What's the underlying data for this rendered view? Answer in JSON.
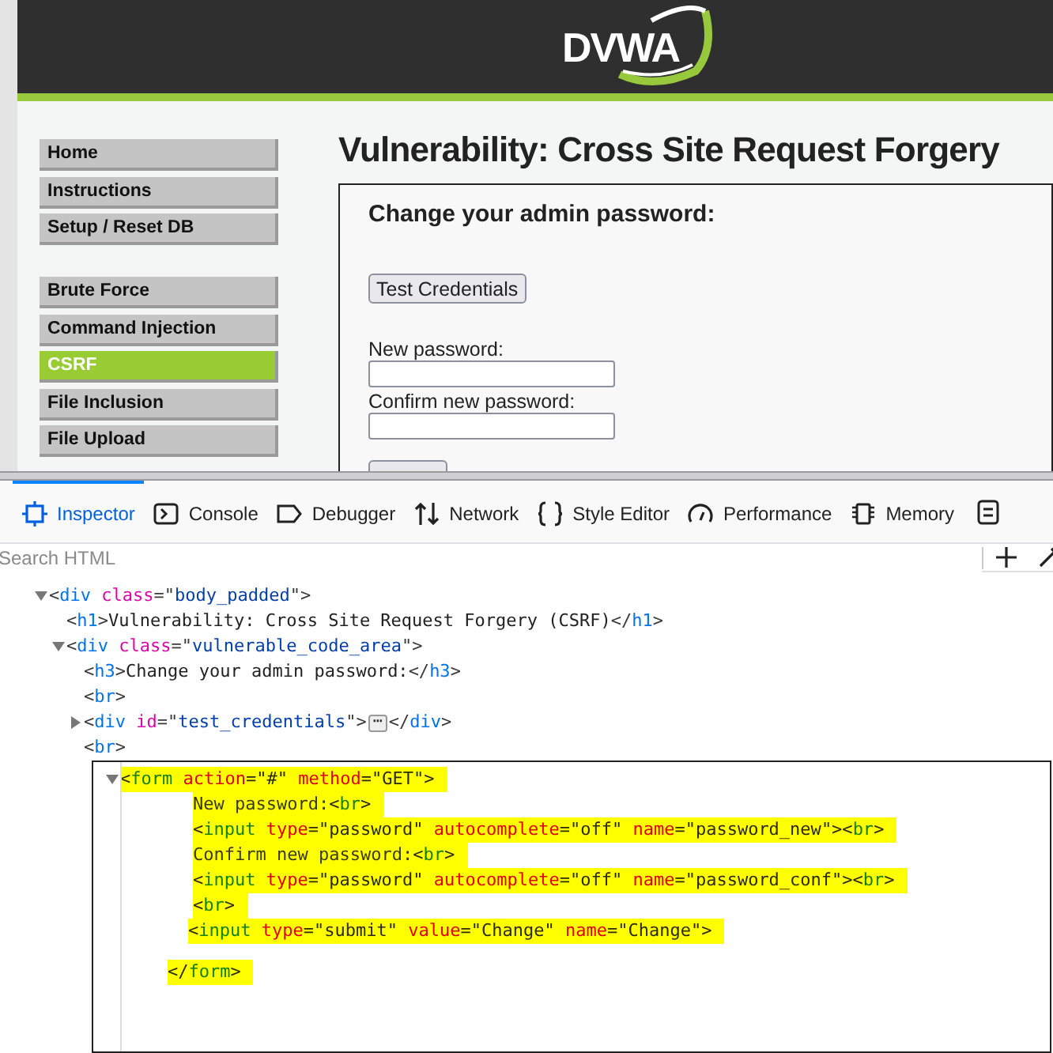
{
  "page": {
    "logo": "DVWA",
    "menu_groups": [
      [
        {
          "label": "Home",
          "selected": false
        },
        {
          "label": "Instructions",
          "selected": false
        },
        {
          "label": "Setup / Reset DB",
          "selected": false
        }
      ],
      [
        {
          "label": "Brute Force",
          "selected": false
        },
        {
          "label": "Command Injection",
          "selected": false
        },
        {
          "label": "CSRF",
          "selected": true
        },
        {
          "label": "File Inclusion",
          "selected": false
        },
        {
          "label": "File Upload",
          "selected": false
        }
      ]
    ],
    "title": "Vulnerability: Cross Site Request Forgery",
    "form": {
      "heading": "Change your admin password:",
      "test_button": "Test Credentials",
      "new_label": "New password:",
      "confirm_label": "Confirm new password:"
    }
  },
  "devtools": {
    "tabs": [
      {
        "label": "Inspector",
        "selected": true
      },
      {
        "label": "Console",
        "selected": false
      },
      {
        "label": "Debugger",
        "selected": false
      },
      {
        "label": "Network",
        "selected": false
      },
      {
        "label": "Style Editor",
        "selected": false
      },
      {
        "label": "Performance",
        "selected": false
      },
      {
        "label": "Memory",
        "selected": false
      }
    ],
    "search": {
      "placeholder": "Search HTML"
    },
    "tree": [
      {
        "expanded": true,
        "tokens": [
          {
            "kind": "p",
            "text": "<"
          },
          {
            "kind": "tag",
            "text": "div"
          },
          {
            "kind": "attr",
            "text": " class"
          },
          {
            "kind": "p",
            "text": "=\""
          },
          {
            "kind": "val",
            "text": "body_padded"
          },
          {
            "kind": "p",
            "text": "\">"
          }
        ],
        "children": [
          {
            "tokens": [
              {
                "kind": "p",
                "text": "<"
              },
              {
                "kind": "tag",
                "text": "h1"
              },
              {
                "kind": "p",
                "text": ">"
              },
              {
                "kind": "text",
                "text": "Vulnerability: Cross Site Request Forgery (CSRF)"
              },
              {
                "kind": "p",
                "text": "</"
              },
              {
                "kind": "tag",
                "text": "h1"
              },
              {
                "kind": "p",
                "text": ">"
              }
            ]
          },
          {
            "expanded": true,
            "tokens": [
              {
                "kind": "p",
                "text": "<"
              },
              {
                "kind": "tag",
                "text": "div"
              },
              {
                "kind": "attr",
                "text": " class"
              },
              {
                "kind": "p",
                "text": "=\""
              },
              {
                "kind": "val",
                "text": "vulnerable_code_area"
              },
              {
                "kind": "p",
                "text": "\">"
              }
            ],
            "children": [
              {
                "tokens": [
                  {
                    "kind": "p",
                    "text": "<"
                  },
                  {
                    "kind": "tag",
                    "text": "h3"
                  },
                  {
                    "kind": "p",
                    "text": ">"
                  },
                  {
                    "kind": "text",
                    "text": "Change your admin password:"
                  },
                  {
                    "kind": "p",
                    "text": "</"
                  },
                  {
                    "kind": "tag",
                    "text": "h3"
                  },
                  {
                    "kind": "p",
                    "text": ">"
                  }
                ]
              },
              {
                "tokens": [
                  {
                    "kind": "p",
                    "text": "<"
                  },
                  {
                    "kind": "tag",
                    "text": "br"
                  },
                  {
                    "kind": "p",
                    "text": ">"
                  }
                ]
              },
              {
                "expanded": false,
                "tokens": [
                  {
                    "kind": "p",
                    "text": "<"
                  },
                  {
                    "kind": "tag",
                    "text": "div"
                  },
                  {
                    "kind": "attr",
                    "text": " id"
                  },
                  {
                    "kind": "p",
                    "text": "=\""
                  },
                  {
                    "kind": "val",
                    "text": "test_credentials"
                  },
                  {
                    "kind": "p",
                    "text": "\">"
                  },
                  {
                    "kind": "more",
                    "text": "⋯"
                  },
                  {
                    "kind": "p",
                    "text": "</"
                  },
                  {
                    "kind": "tag",
                    "text": "div"
                  },
                  {
                    "kind": "p",
                    "text": ">"
                  }
                ]
              },
              {
                "tokens": [
                  {
                    "kind": "p",
                    "text": "<"
                  },
                  {
                    "kind": "tag",
                    "text": "br"
                  },
                  {
                    "kind": "p",
                    "text": ">"
                  }
                ]
              },
              {
                "expanded": true,
                "boxed": true,
                "highlighted": true,
                "tokens": [
                  {
                    "kind": "p",
                    "text": "<"
                  },
                  {
                    "kind": "tag",
                    "text": "form"
                  },
                  {
                    "kind": "attr",
                    "text": " action"
                  },
                  {
                    "kind": "p",
                    "text": "=\""
                  },
                  {
                    "kind": "val",
                    "text": "#"
                  },
                  {
                    "kind": "p",
                    "text": "\""
                  },
                  {
                    "kind": "attr",
                    "text": " method"
                  },
                  {
                    "kind": "p",
                    "text": "=\""
                  },
                  {
                    "kind": "val",
                    "text": "GET"
                  },
                  {
                    "kind": "p",
                    "text": "\">"
                  }
                ],
                "children": [
                  {
                    "highlighted": true,
                    "tokens": [
                      {
                        "kind": "text",
                        "text": "New password:"
                      },
                      {
                        "kind": "p",
                        "text": "<"
                      },
                      {
                        "kind": "tag",
                        "text": "br"
                      },
                      {
                        "kind": "p",
                        "text": ">"
                      }
                    ]
                  },
                  {
                    "highlighted": true,
                    "tokens": [
                      {
                        "kind": "p",
                        "text": "<"
                      },
                      {
                        "kind": "tag",
                        "text": "input"
                      },
                      {
                        "kind": "attr",
                        "text": " type"
                      },
                      {
                        "kind": "p",
                        "text": "=\""
                      },
                      {
                        "kind": "val",
                        "text": "password"
                      },
                      {
                        "kind": "p",
                        "text": "\""
                      },
                      {
                        "kind": "attr",
                        "text": " autocomplete"
                      },
                      {
                        "kind": "p",
                        "text": "=\""
                      },
                      {
                        "kind": "val",
                        "text": "off"
                      },
                      {
                        "kind": "p",
                        "text": "\""
                      },
                      {
                        "kind": "attr",
                        "text": " name"
                      },
                      {
                        "kind": "p",
                        "text": "=\""
                      },
                      {
                        "kind": "val",
                        "text": "password_new"
                      },
                      {
                        "kind": "p",
                        "text": "\"><"
                      },
                      {
                        "kind": "tag",
                        "text": "br"
                      },
                      {
                        "kind": "p",
                        "text": ">"
                      }
                    ]
                  },
                  {
                    "highlighted": true,
                    "tokens": [
                      {
                        "kind": "text",
                        "text": "Confirm new password:"
                      },
                      {
                        "kind": "p",
                        "text": "<"
                      },
                      {
                        "kind": "tag",
                        "text": "br"
                      },
                      {
                        "kind": "p",
                        "text": ">"
                      }
                    ]
                  },
                  {
                    "highlighted": true,
                    "tokens": [
                      {
                        "kind": "p",
                        "text": "<"
                      },
                      {
                        "kind": "tag",
                        "text": "input"
                      },
                      {
                        "kind": "attr",
                        "text": " type"
                      },
                      {
                        "kind": "p",
                        "text": "=\""
                      },
                      {
                        "kind": "val",
                        "text": "password"
                      },
                      {
                        "kind": "p",
                        "text": "\""
                      },
                      {
                        "kind": "attr",
                        "text": " autocomplete"
                      },
                      {
                        "kind": "p",
                        "text": "=\""
                      },
                      {
                        "kind": "val",
                        "text": "off"
                      },
                      {
                        "kind": "p",
                        "text": "\""
                      },
                      {
                        "kind": "attr",
                        "text": " name"
                      },
                      {
                        "kind": "p",
                        "text": "=\""
                      },
                      {
                        "kind": "val",
                        "text": "password_conf"
                      },
                      {
                        "kind": "p",
                        "text": "\"><"
                      },
                      {
                        "kind": "tag",
                        "text": "br"
                      },
                      {
                        "kind": "p",
                        "text": ">"
                      }
                    ]
                  },
                  {
                    "highlighted": true,
                    "tokens": [
                      {
                        "kind": "p",
                        "text": "<"
                      },
                      {
                        "kind": "tag",
                        "text": "br"
                      },
                      {
                        "kind": "p",
                        "text": ">"
                      }
                    ]
                  },
                  {
                    "highlighted": true,
                    "tokens": [
                      {
                        "kind": "p",
                        "text": "<"
                      },
                      {
                        "kind": "tag",
                        "text": "input"
                      },
                      {
                        "kind": "attr",
                        "text": " type"
                      },
                      {
                        "kind": "p",
                        "text": "=\""
                      },
                      {
                        "kind": "val",
                        "text": "submit"
                      },
                      {
                        "kind": "p",
                        "text": "\""
                      },
                      {
                        "kind": "attr",
                        "text": " value"
                      },
                      {
                        "kind": "p",
                        "text": "=\""
                      },
                      {
                        "kind": "val",
                        "text": "Change"
                      },
                      {
                        "kind": "p",
                        "text": "\""
                      },
                      {
                        "kind": "attr",
                        "text": " name"
                      },
                      {
                        "kind": "p",
                        "text": "=\""
                      },
                      {
                        "kind": "val",
                        "text": "Change"
                      },
                      {
                        "kind": "p",
                        "text": "\">"
                      }
                    ]
                  }
                ],
                "close": {
                  "highlighted": true,
                  "tokens": [
                    {
                      "kind": "p",
                      "text": "</"
                    },
                    {
                      "kind": "tag",
                      "text": "form"
                    },
                    {
                      "kind": "p",
                      "text": ">"
                    }
                  ]
                }
              }
            ]
          }
        ]
      }
    ]
  }
}
